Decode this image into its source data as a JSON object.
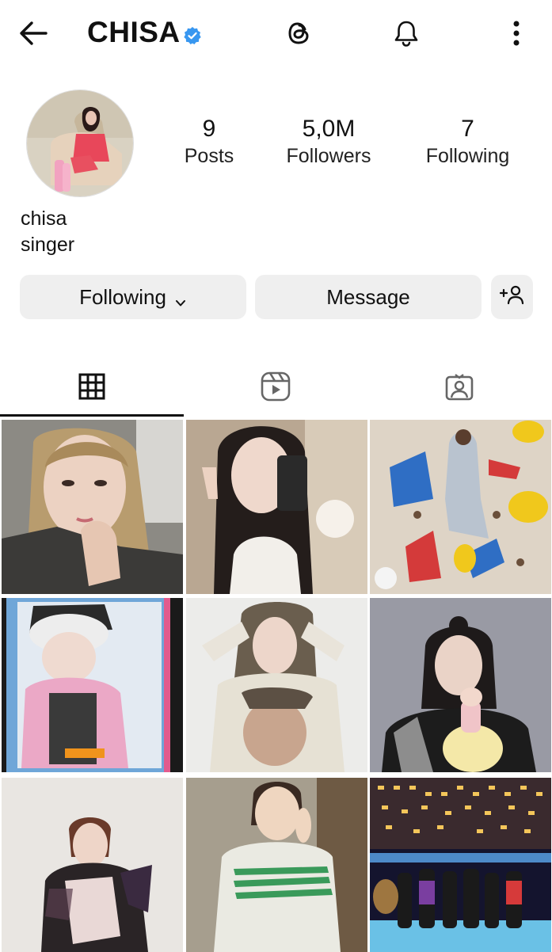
{
  "header": {
    "username": "CHISA",
    "verified": true,
    "icons": [
      "back-arrow-icon",
      "verified-badge-icon",
      "threads-icon",
      "bell-icon",
      "more-vertical-icon"
    ]
  },
  "profile": {
    "name": "chisa",
    "bio": "singer",
    "stats": {
      "posts": {
        "value": "9",
        "label": "Posts"
      },
      "followers": {
        "value": "5,0M",
        "label": "Followers"
      },
      "following": {
        "value": "7",
        "label": "Following"
      }
    }
  },
  "actions": {
    "following_label": "Following",
    "message_label": "Message"
  },
  "tabs": [
    "grid-icon",
    "reels-icon",
    "tagged-icon"
  ],
  "colors": {
    "verified": "#3897f0",
    "button_bg": "#efefef",
    "text": "#111111"
  },
  "posts": [
    {
      "id": "post-1"
    },
    {
      "id": "post-2"
    },
    {
      "id": "post-3"
    },
    {
      "id": "post-4"
    },
    {
      "id": "post-5"
    },
    {
      "id": "post-6"
    },
    {
      "id": "post-7"
    },
    {
      "id": "post-8"
    },
    {
      "id": "post-9"
    }
  ]
}
